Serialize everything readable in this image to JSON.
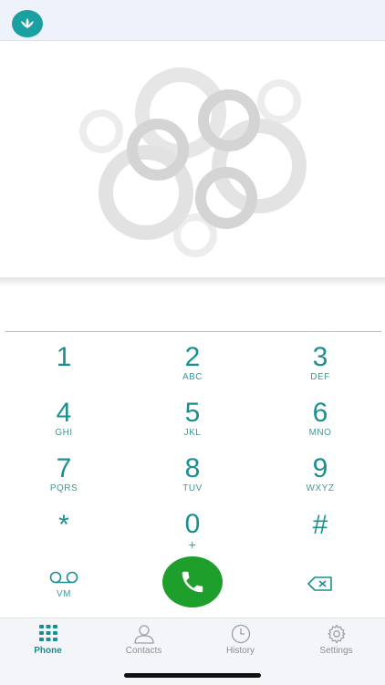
{
  "colors": {
    "accent": "#1b8f8f",
    "call": "#1e9e2b",
    "topbar": "#eef2fb"
  },
  "logo": {
    "icon": "lotus-icon"
  },
  "dialer": {
    "number": "",
    "keys": [
      {
        "digit": "1",
        "letters": ""
      },
      {
        "digit": "2",
        "letters": "ABC"
      },
      {
        "digit": "3",
        "letters": "DEF"
      },
      {
        "digit": "4",
        "letters": "GHI"
      },
      {
        "digit": "5",
        "letters": "JKL"
      },
      {
        "digit": "6",
        "letters": "MNO"
      },
      {
        "digit": "7",
        "letters": "PQRS"
      },
      {
        "digit": "8",
        "letters": "TUV"
      },
      {
        "digit": "9",
        "letters": "WXYZ"
      },
      {
        "digit": "*",
        "letters": ""
      },
      {
        "digit": "0",
        "letters": "+"
      },
      {
        "digit": "#",
        "letters": ""
      }
    ],
    "voicemail_label": "VM"
  },
  "tabs": [
    {
      "label": "Phone",
      "icon": "keypad-grid-icon",
      "active": true
    },
    {
      "label": "Contacts",
      "icon": "person-icon",
      "active": false
    },
    {
      "label": "History",
      "icon": "clock-icon",
      "active": false
    },
    {
      "label": "Settings",
      "icon": "gear-icon",
      "active": false
    }
  ]
}
